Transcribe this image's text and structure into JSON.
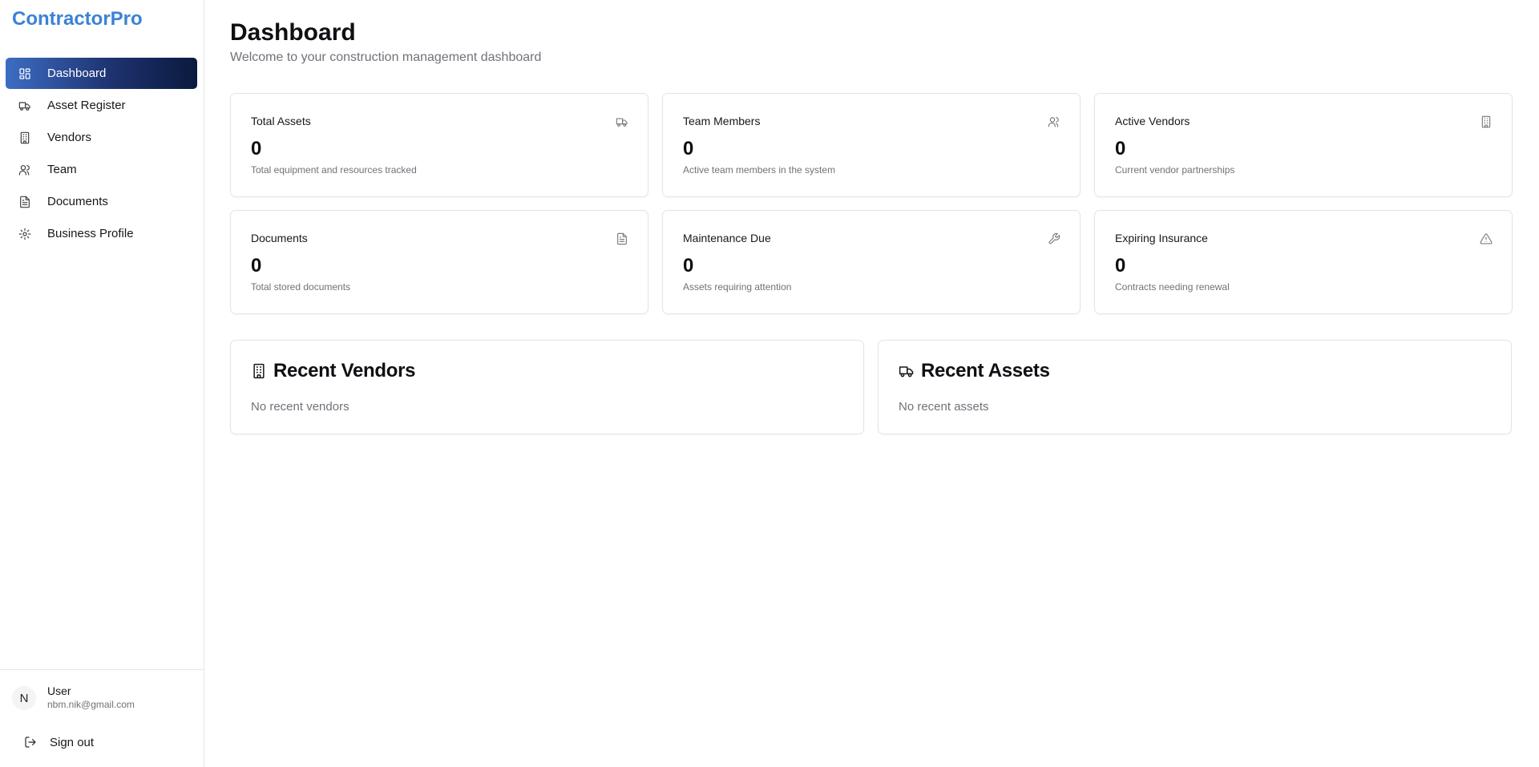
{
  "app": {
    "brand": "ContractorPro",
    "brand_color": "#3b82d6"
  },
  "sidebar": {
    "items": [
      {
        "label": "Dashboard",
        "icon": "dashboard-icon",
        "active": true
      },
      {
        "label": "Asset Register",
        "icon": "truck-icon",
        "active": false
      },
      {
        "label": "Vendors",
        "icon": "building-icon",
        "active": false
      },
      {
        "label": "Team",
        "icon": "users-icon",
        "active": false
      },
      {
        "label": "Documents",
        "icon": "file-text-icon",
        "active": false
      },
      {
        "label": "Business Profile",
        "icon": "gear-icon",
        "active": false
      }
    ],
    "user": {
      "initial": "N",
      "name": "User",
      "email": "nbm.nik@gmail.com"
    },
    "signout_label": "Sign out"
  },
  "header": {
    "title": "Dashboard",
    "subtitle": "Welcome to your construction management dashboard"
  },
  "stats": [
    {
      "label": "Total Assets",
      "value": "0",
      "desc": "Total equipment and resources tracked",
      "icon": "truck-icon"
    },
    {
      "label": "Team Members",
      "value": "0",
      "desc": "Active team members in the system",
      "icon": "users-icon"
    },
    {
      "label": "Active Vendors",
      "value": "0",
      "desc": "Current vendor partnerships",
      "icon": "building-icon"
    },
    {
      "label": "Documents",
      "value": "0",
      "desc": "Total stored documents",
      "icon": "file-text-icon"
    },
    {
      "label": "Maintenance Due",
      "value": "0",
      "desc": "Assets requiring attention",
      "icon": "wrench-icon"
    },
    {
      "label": "Expiring Insurance",
      "value": "0",
      "desc": "Contracts needing renewal",
      "icon": "alert-triangle-icon"
    }
  ],
  "panels": {
    "recent_vendors": {
      "title": "Recent Vendors",
      "empty": "No recent vendors",
      "icon": "building-icon"
    },
    "recent_assets": {
      "title": "Recent Assets",
      "empty": "No recent assets",
      "icon": "truck-icon"
    }
  }
}
